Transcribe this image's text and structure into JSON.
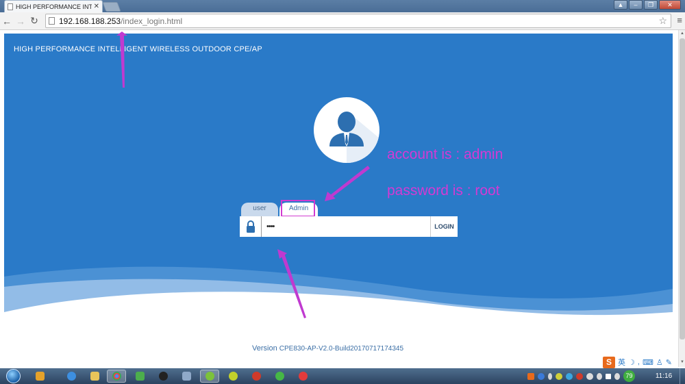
{
  "browser": {
    "tab_title": "HIGH PERFORMANCE INTE",
    "url_host": "192.168.188.253",
    "url_path": "/index_login.html"
  },
  "page": {
    "heading": "HIGH PERFORMANCE INTELLIGENT WIRELESS OUTDOOR CPE/AP",
    "tabs": [
      {
        "label": "user",
        "selected": false
      },
      {
        "label": "Admin",
        "selected": true
      }
    ],
    "password_value": "••••",
    "login_label": "LOGIN",
    "version_label": "Version",
    "version_build": "CPE830-AP-V2.0-Build20170717174345"
  },
  "annotations": {
    "account": "account is : admin",
    "password": "password is : root",
    "color": "#d43ad4"
  },
  "ime": {
    "badge": "S",
    "lang": "英"
  },
  "taskbar": {
    "clock": "11:16",
    "tray_badge": "79"
  },
  "colors": {
    "page_blue": "#2a7ac8",
    "accent_annotation": "#d43ad4"
  }
}
